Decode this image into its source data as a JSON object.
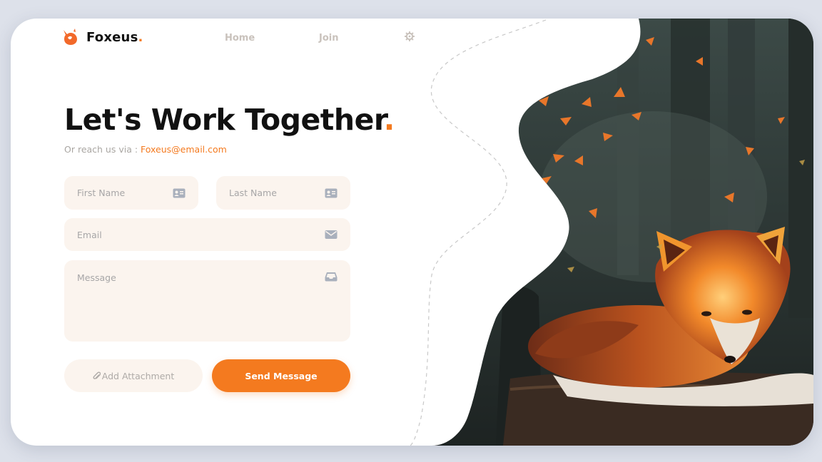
{
  "brand": {
    "name": "Foxeus",
    "dot": ".",
    "logo_icon": "fox-logo-icon"
  },
  "nav": {
    "home": "Home",
    "join": "Join",
    "settings_icon": "gear-icon"
  },
  "hero": {
    "headline": "Let's Work Together",
    "headline_dot": ".",
    "reach_prefix": "Or reach us via : ",
    "email": "Foxeus@email.com"
  },
  "form": {
    "first_name_placeholder": "First Name",
    "last_name_placeholder": "Last Name",
    "email_placeholder": "Email",
    "message_placeholder": "Message",
    "name_icon": "id-card-icon",
    "email_icon": "envelope-icon",
    "message_icon": "inbox-icon"
  },
  "actions": {
    "attach_label": "Add Attachment",
    "attach_icon": "paperclip-icon",
    "send_label": "Send Message"
  },
  "colors": {
    "accent": "#f47a1f",
    "field_bg": "#fbf4ee",
    "text_dark": "#111111",
    "muted": "#a9a6a2"
  },
  "illustration": {
    "subject": "fox-in-autumn-forest-image"
  }
}
